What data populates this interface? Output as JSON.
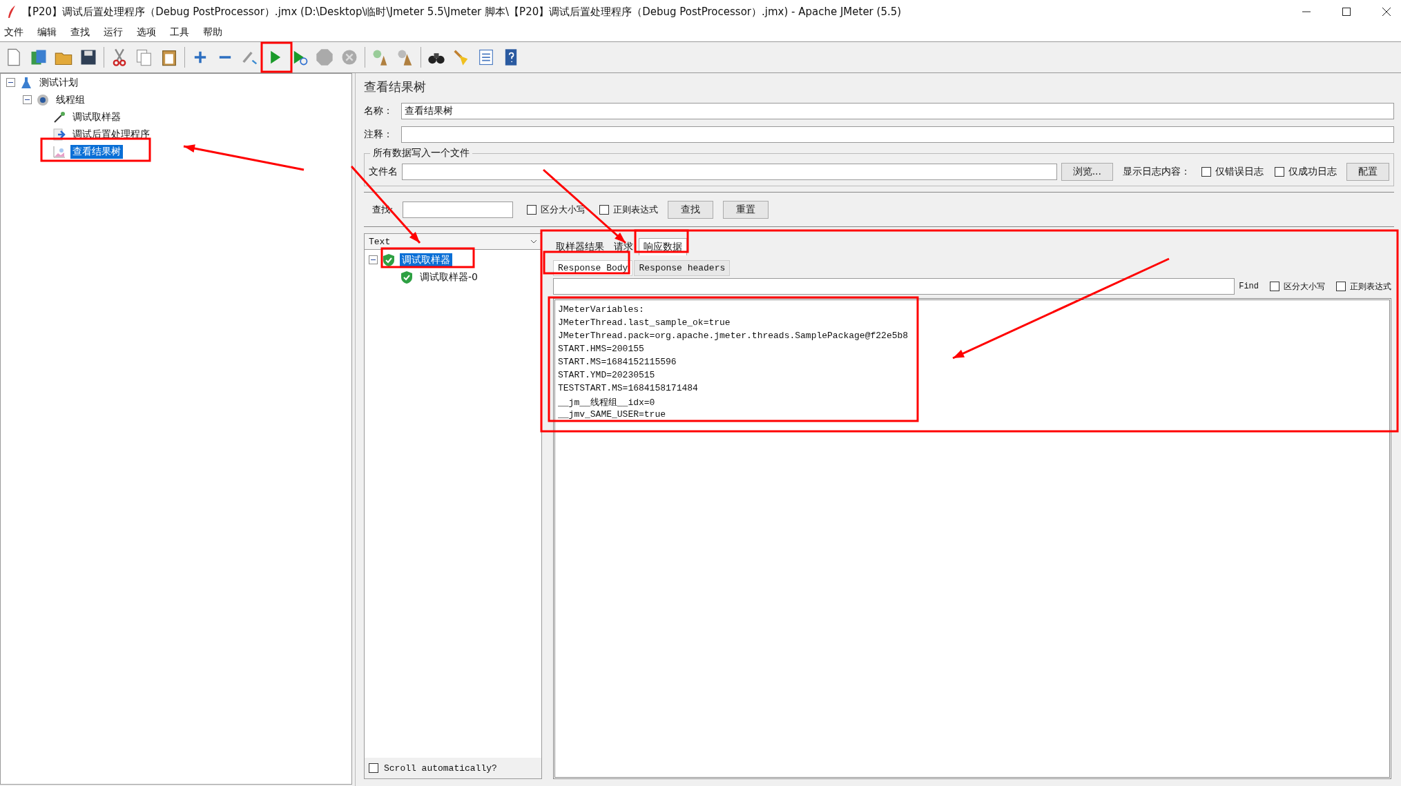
{
  "window": {
    "title": "【P20】调试后置处理程序（Debug PostProcessor）.jmx (D:\\Desktop\\临时\\Jmeter 5.5\\Jmeter 脚本\\【P20】调试后置处理程序（Debug PostProcessor）.jmx) - Apache JMeter (5.5)"
  },
  "menu": [
    "文件",
    "编辑",
    "查找",
    "运行",
    "选项",
    "工具",
    "帮助"
  ],
  "tree": [
    {
      "label": "测试计划",
      "kind": "plan",
      "expanded": true,
      "selected": false,
      "children": [
        {
          "label": "线程组",
          "kind": "threadgroup",
          "expanded": true,
          "selected": false,
          "children": [
            {
              "label": "调试取样器",
              "kind": "sampler",
              "selected": false
            },
            {
              "label": "调试后置处理程序",
              "kind": "postprocessor",
              "selected": false
            },
            {
              "label": "查看结果树",
              "kind": "listener",
              "selected": true
            }
          ]
        }
      ]
    }
  ],
  "panel": {
    "title": "查看结果树",
    "name_label": "名称：",
    "name_value": "查看结果树",
    "comment_label": "注释：",
    "file_group": "所有数据写入一个文件",
    "file_label": "文件名",
    "browse_button": "浏览...",
    "log_label": "显示日志内容：",
    "log_options": [
      {
        "label": "仅错误日志",
        "checked": false
      },
      {
        "label": "仅成功日志",
        "checked": false
      }
    ],
    "config_button": "配置"
  },
  "search": {
    "label": "查找:",
    "options": [
      {
        "label": "区分大小写",
        "checked": false
      },
      {
        "label": "正则表达式",
        "checked": false
      }
    ],
    "find_button": "查找",
    "reset_button": "重置"
  },
  "results": {
    "renderer": "Text",
    "nodes": [
      {
        "label": "调试取样器",
        "expanded": true,
        "selected": true,
        "children": [
          {
            "label": "调试取样器-0",
            "selected": false
          }
        ]
      }
    ],
    "scroll_label": "Scroll automatically?",
    "scroll_checked": false,
    "tabs": [
      {
        "label": "取样器结果",
        "selected": false
      },
      {
        "label": "请求",
        "selected": false
      },
      {
        "label": "响应数据",
        "selected": true
      }
    ],
    "subtabs": [
      {
        "label": "Response Body",
        "selected": true
      },
      {
        "label": "Response headers",
        "selected": false
      }
    ],
    "find_label": "Find",
    "find_options": [
      {
        "label": "区分大小写",
        "checked": false
      },
      {
        "label": "正则表达式",
        "checked": false
      }
    ],
    "body": [
      "JMeterVariables:",
      "JMeterThread.last_sample_ok=true",
      "JMeterThread.pack=org.apache.jmeter.threads.SamplePackage@f22e5b8",
      "START.HMS=200155",
      "START.MS=1684152115596",
      "START.YMD=20230515",
      "TESTSTART.MS=1684158171484",
      "__jm__线程组__idx=0",
      "__jmv_SAME_USER=true"
    ]
  }
}
